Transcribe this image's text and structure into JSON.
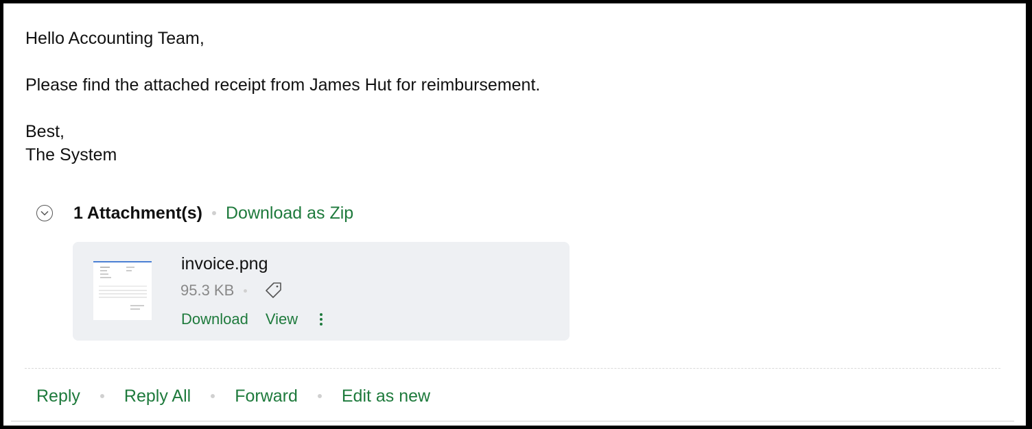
{
  "message": {
    "greeting": "Hello Accounting Team,",
    "line1": "Please find the attached receipt from James Hut for reimbursement.",
    "signoff": "Best,",
    "signature": "The System"
  },
  "attachments": {
    "count_label": "1 Attachment(s)",
    "download_zip_label": "Download as Zip",
    "items": [
      {
        "filename": "invoice.png",
        "size": "95.3 KB",
        "download_label": "Download",
        "view_label": "View"
      }
    ]
  },
  "actions": {
    "reply": "Reply",
    "reply_all": "Reply All",
    "forward": "Forward",
    "edit_as_new": "Edit as new"
  },
  "colors": {
    "link": "#1e7a3c",
    "card_bg": "#eef0f3"
  }
}
